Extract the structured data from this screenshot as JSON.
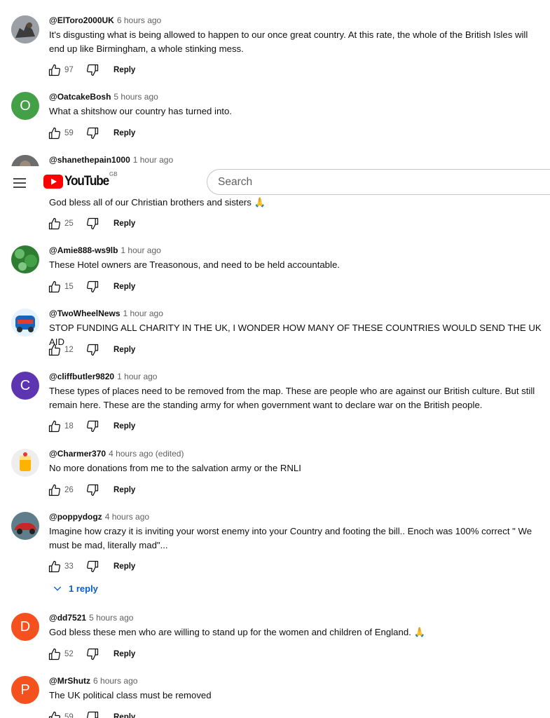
{
  "masthead": {
    "logo_text": "YouTube",
    "region": "GB",
    "search_placeholder": "Search"
  },
  "reply_label": "Reply",
  "comments": [
    {
      "author": "@ElToro2000UK",
      "time": "6 hours ago",
      "text": "It's disgusting what is being allowed to happen to our once great country. At this rate, the whole of the British Isles will end up like Birmingham, a whole stinking mess.",
      "likes": "97",
      "avatar": "photo"
    },
    {
      "author": "@OatcakeBosh",
      "time": "5 hours ago",
      "text": "What a shitshow our country has turned into.",
      "likes": "59",
      "avatar_letter": "O",
      "avatar_color": "#43a047"
    },
    {
      "author": "@shanethepain1000",
      "time": "1 hour ago",
      "text": "God bless all of our Christian brothers and sisters 🙏",
      "likes": "25",
      "avatar": "photo"
    },
    {
      "author": "@Amie888-ws9lb",
      "time": "1 hour ago",
      "text": "These Hotel owners are Treasonous, and need to be held accountable.",
      "likes": "15",
      "avatar": "photo"
    },
    {
      "author": "@TwoWheelNews",
      "time": "1 hour ago",
      "text": "STOP FUNDING ALL CHARITY IN THE UK, I WONDER HOW MANY OF THESE COUNTRIES WOULD SEND THE UK AID",
      "likes": "12",
      "avatar": "logo"
    },
    {
      "author": "@cliffbutler9820",
      "time": "1 hour ago",
      "text": "These types of places need to be removed from the map. These are people who are against our British culture. But still remain here. These are the standing army for when government want to declare war on the British people.",
      "likes": "18",
      "avatar_letter": "C",
      "avatar_color": "#5e35b1"
    },
    {
      "author": "@Charmer370",
      "time": "4 hours ago (edited)",
      "text": "No more donations from me to the salvation army  or the RNLI",
      "likes": "26",
      "avatar": "photo"
    },
    {
      "author": "@poppydogz",
      "time": "4 hours ago",
      "text": "Imagine how crazy it is inviting your worst enemy into your Country and footing the bill.. Enoch was 100% correct \" We must be mad, literally mad\"...",
      "likes": "33",
      "avatar": "photo",
      "replies": "1 reply"
    },
    {
      "author": "@dd7521",
      "time": "5 hours ago",
      "text": "God bless these men who are willing to stand up for the women and children of England. 🙏",
      "likes": "52",
      "avatar_letter": "D",
      "avatar_color": "#f4511e"
    },
    {
      "author": "@MrShutz",
      "time": "6 hours ago",
      "text": "The UK political class must be removed",
      "likes": "59",
      "avatar_letter": "P",
      "avatar_color": "#f4511e"
    }
  ],
  "colors": {
    "accent_blue": "#065fd4",
    "youtube_red": "#ff0000",
    "secondary_text": "#606060"
  }
}
